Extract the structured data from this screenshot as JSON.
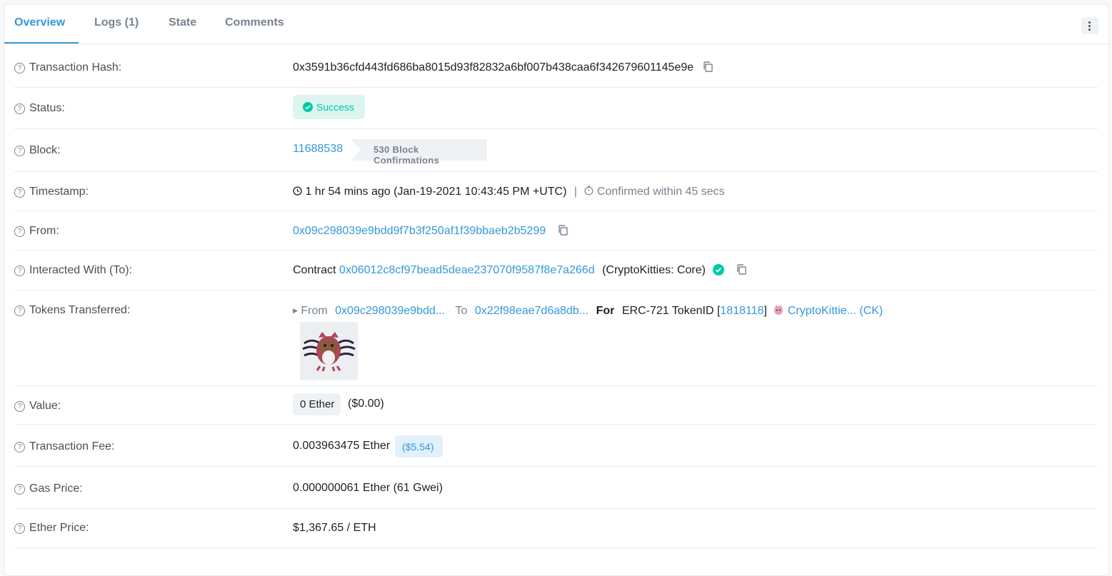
{
  "tabs": [
    {
      "label": "Overview",
      "active": true
    },
    {
      "label": "Logs (1)",
      "active": false
    },
    {
      "label": "State",
      "active": false
    },
    {
      "label": "Comments",
      "active": false
    }
  ],
  "help_icon": "question-circle-icon",
  "fields": {
    "tx_hash": {
      "label": "Transaction Hash:",
      "value": "0x3591b36cfd443fd686ba8015d93f82832a6bf007b438caa6f342679601145e9e"
    },
    "status": {
      "label": "Status:",
      "value": "Success"
    },
    "block": {
      "label": "Block:",
      "number": "11688538",
      "confirmations": "530 Block Confirmations"
    },
    "timestamp": {
      "label": "Timestamp:",
      "value": "1 hr 54 mins ago (Jan-19-2021 10:43:45 PM +UTC)",
      "separator": "|",
      "confirmed": "Confirmed within 45 secs"
    },
    "from": {
      "label": "From:",
      "address": "0x09c298039e9bdd9f7b3f250af1f39bbaeb2b5299"
    },
    "interacted": {
      "label": "Interacted With (To):",
      "prefix": "Contract",
      "address": "0x06012c8cf97bead5deae237070f9587f8e7a266d",
      "name": "(CryptoKitties: Core)"
    },
    "tokens": {
      "label": "Tokens Transferred:",
      "from_label": "From",
      "from_addr": "0x09c298039e9bdd...",
      "to_label": "To",
      "to_addr": "0x22f98eae7d6a8db...",
      "for_label": "For",
      "standard": "ERC-721 TokenID [",
      "token_id": "1818118",
      "bracket_close": "]",
      "token_name": "CryptoKittie... (CK)"
    },
    "value": {
      "label": "Value:",
      "amount": "0 Ether",
      "usd": "($0.00)"
    },
    "fee": {
      "label": "Transaction Fee:",
      "amount": "0.003963475 Ether",
      "usd": "($5.54)"
    },
    "gas": {
      "label": "Gas Price:",
      "value": "0.000000061 Ether (61 Gwei)"
    },
    "ether_price": {
      "label": "Ether Price:",
      "value": "$1,367.65 / ETH"
    }
  },
  "colors": {
    "accent": "#3498db",
    "success": "#00c9a7",
    "muted": "#77838f"
  }
}
